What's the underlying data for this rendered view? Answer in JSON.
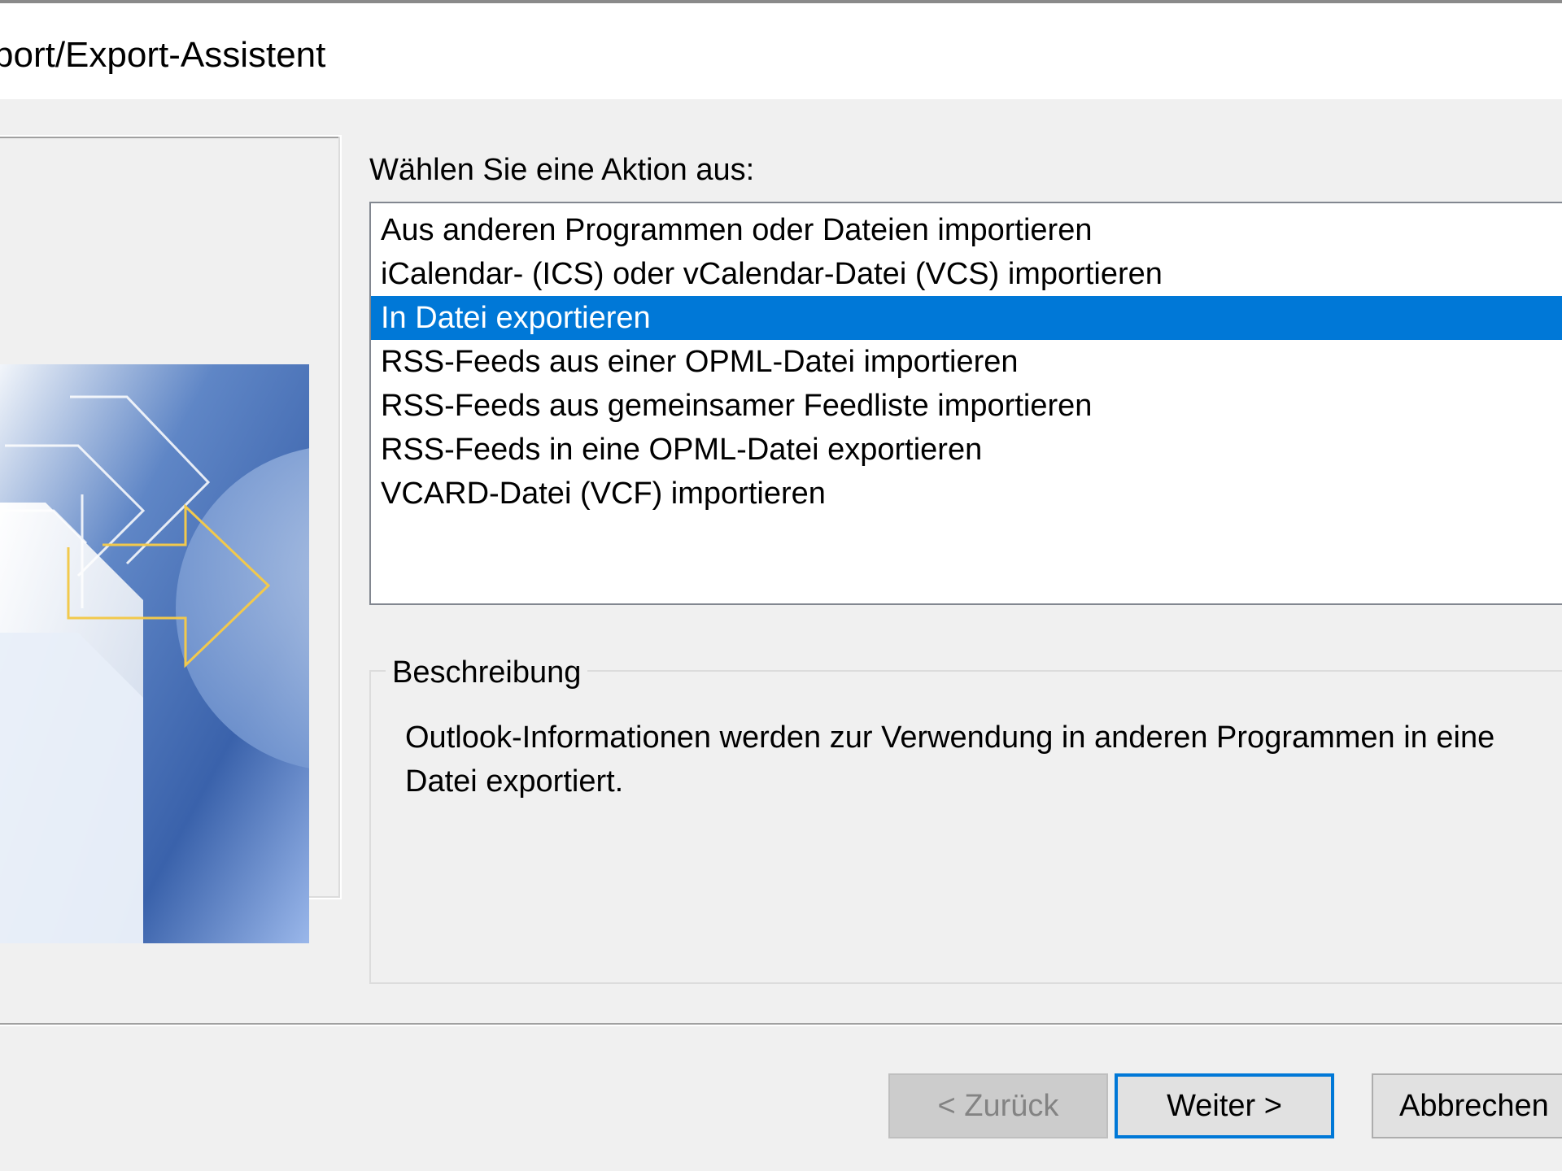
{
  "window": {
    "title": "port/Export-Assistent"
  },
  "actions": {
    "label": "Wählen Sie eine Aktion aus:",
    "items": [
      {
        "label": "Aus anderen Programmen oder Dateien importieren",
        "selected": false
      },
      {
        "label": "iCalendar- (ICS) oder vCalendar-Datei (VCS) importieren",
        "selected": false
      },
      {
        "label": "In Datei exportieren",
        "selected": true
      },
      {
        "label": "RSS-Feeds aus einer OPML-Datei importieren",
        "selected": false
      },
      {
        "label": "RSS-Feeds aus gemeinsamer Feedliste importieren",
        "selected": false
      },
      {
        "label": "RSS-Feeds in eine OPML-Datei exportieren",
        "selected": false
      },
      {
        "label": "VCARD-Datei (VCF) importieren",
        "selected": false
      }
    ]
  },
  "description": {
    "legend": "Beschreibung",
    "text": "Outlook-Informationen werden zur Verwendung in anderen Programmen in eine Datei exportiert."
  },
  "buttons": {
    "back": "< Zurück",
    "next": "Weiter >",
    "cancel": "Abbrechen"
  },
  "colors": {
    "selection": "#0078d7",
    "accent_border": "#0078d7",
    "graphic_arrow": "#f2c94c"
  }
}
